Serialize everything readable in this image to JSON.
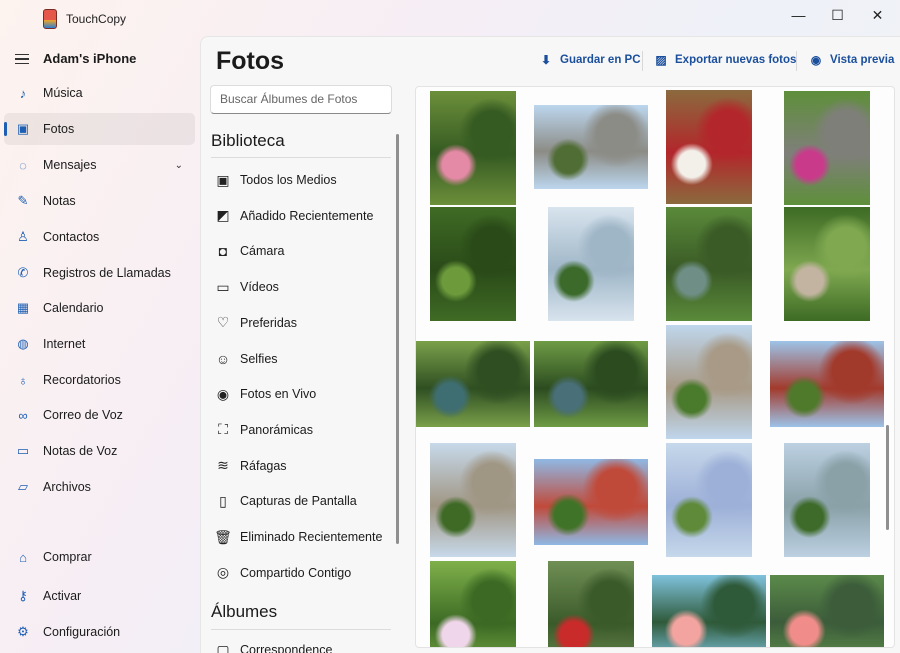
{
  "window": {
    "title": "TouchCopy",
    "minimize": "—",
    "maximize": "☐",
    "close": "✕"
  },
  "sidebar": {
    "device_name": "Adam's iPhone",
    "items": [
      {
        "label": "Música",
        "icon": "music-icon",
        "glyph": "♪"
      },
      {
        "label": "Fotos",
        "icon": "photos-icon",
        "glyph": "▣",
        "active": true
      },
      {
        "label": "Mensajes",
        "icon": "messages-icon",
        "glyph": "◌",
        "expand": "⌄"
      },
      {
        "label": "Notas",
        "icon": "notes-icon",
        "glyph": "✎"
      },
      {
        "label": "Contactos",
        "icon": "contacts-icon",
        "glyph": "♙"
      },
      {
        "label": "Registros de Llamadas",
        "icon": "phone-icon",
        "glyph": "✆"
      },
      {
        "label": "Calendario",
        "icon": "calendar-icon",
        "glyph": "▦"
      },
      {
        "label": "Internet",
        "icon": "globe-icon",
        "glyph": "◍"
      },
      {
        "label": "Recordatorios",
        "icon": "reminders-icon",
        "glyph": "♁"
      },
      {
        "label": "Correo de Voz",
        "icon": "voicemail-icon",
        "glyph": "∞"
      },
      {
        "label": "Notas de Voz",
        "icon": "voice-memo-icon",
        "glyph": "▭"
      },
      {
        "label": "Archivos",
        "icon": "folder-icon",
        "glyph": "▱"
      }
    ],
    "bottom": [
      {
        "label": "Comprar",
        "icon": "cart-icon",
        "glyph": "⌂"
      },
      {
        "label": "Activar",
        "icon": "key-icon",
        "glyph": "⚷"
      },
      {
        "label": "Configuración",
        "icon": "gear-icon",
        "glyph": "⚙"
      }
    ]
  },
  "main": {
    "title": "Fotos",
    "toolbar": {
      "save": {
        "label": "Guardar en PC",
        "glyph": "⬇"
      },
      "export": {
        "label": "Exportar nuevas fotos",
        "glyph": "▨"
      },
      "preview": {
        "label": "Vista previa",
        "glyph": "◉"
      }
    },
    "search_placeholder": "Buscar Álbumes de Fotos",
    "library_heading": "Biblioteca",
    "library": [
      {
        "label": "Todos los Medios",
        "icon": "all-media-icon",
        "glyph": "▣"
      },
      {
        "label": "Añadido Recientemente",
        "icon": "recently-added-icon",
        "glyph": "◩"
      },
      {
        "label": "Cámara",
        "icon": "camera-icon",
        "glyph": "◘"
      },
      {
        "label": "Vídeos",
        "icon": "video-icon",
        "glyph": "▭"
      },
      {
        "label": "Preferidas",
        "icon": "heart-icon",
        "glyph": "♡"
      },
      {
        "label": "Selfies",
        "icon": "selfie-icon",
        "glyph": "☺"
      },
      {
        "label": "Fotos en Vivo",
        "icon": "live-photo-icon",
        "glyph": "◉"
      },
      {
        "label": "Panorámicas",
        "icon": "panorama-icon",
        "glyph": "⛶"
      },
      {
        "label": "Ráfagas",
        "icon": "burst-icon",
        "glyph": "≋"
      },
      {
        "label": "Capturas de Pantalla",
        "icon": "screenshot-icon",
        "glyph": "▯"
      },
      {
        "label": "Eliminado Recientemente",
        "icon": "trash-icon",
        "glyph": "🗑"
      },
      {
        "label": "Compartido Contigo",
        "icon": "shared-icon",
        "glyph": "◎"
      }
    ],
    "albums_heading": "Álbumes",
    "albums": [
      {
        "label": "Correspondence",
        "icon": "album-icon",
        "glyph": "▢"
      }
    ]
  },
  "photos": [
    {
      "subject": "pink flowers",
      "palette": [
        "#6c8f3a",
        "#e58aa6",
        "#355a22"
      ]
    },
    {
      "subject": "dragon tree",
      "palette": [
        "#bcd6ee",
        "#4f6d34",
        "#8c8c86"
      ]
    },
    {
      "subject": "thatched house",
      "palette": [
        "#8b6a3e",
        "#f3f0ea",
        "#b3262b"
      ]
    },
    {
      "subject": "garden wall",
      "palette": [
        "#5e8f3a",
        "#c93a8b",
        "#7f7f7a"
      ]
    },
    {
      "subject": "ferns",
      "palette": [
        "#3f6b25",
        "#6d9b3c",
        "#2a4a18"
      ]
    },
    {
      "subject": "waterfall",
      "palette": [
        "#d8e4ee",
        "#3b6a2a",
        "#9fb6c7"
      ]
    },
    {
      "subject": "pond",
      "palette": [
        "#5a8a3a",
        "#6f8f86",
        "#3a5a26"
      ]
    },
    {
      "subject": "path",
      "palette": [
        "#3d6b24",
        "#c2b4a0",
        "#7fa850"
      ]
    },
    {
      "subject": "pond bridge",
      "palette": [
        "#7aa04a",
        "#3f6e72",
        "#2f4f22"
      ]
    },
    {
      "subject": "pond bridge 2",
      "palette": [
        "#6f9b45",
        "#496f78",
        "#2c4c20"
      ]
    },
    {
      "subject": "palm path",
      "palette": [
        "#bfd6ec",
        "#4a7a2c",
        "#a89a86"
      ]
    },
    {
      "subject": "red pavilion",
      "palette": [
        "#9dc3e8",
        "#4f7a2c",
        "#a23a2c"
      ]
    },
    {
      "subject": "hedge path",
      "palette": [
        "#c7d9ea",
        "#3e6a26",
        "#a09684"
      ]
    },
    {
      "subject": "palms",
      "palette": [
        "#8fb8e4",
        "#3f7428",
        "#c04a3a"
      ]
    },
    {
      "subject": "hydrangeas",
      "palette": [
        "#c6d8ea",
        "#5f8a3a",
        "#9db0d8"
      ]
    },
    {
      "subject": "fountain",
      "palette": [
        "#bcd0e2",
        "#3e6b2a",
        "#8aa1a8"
      ]
    },
    {
      "subject": "orchid",
      "palette": [
        "#7fb04a",
        "#f0d6ea",
        "#3c6a24"
      ]
    },
    {
      "subject": "red flowers",
      "palette": [
        "#6f8f55",
        "#c92b2b",
        "#3b5a2a"
      ]
    },
    {
      "subject": "flamingos 1",
      "palette": [
        "#7fc2dc",
        "#f3a4a0",
        "#2f5a3a"
      ]
    },
    {
      "subject": "flamingos 2",
      "palette": [
        "#5b8a4a",
        "#f08d8a",
        "#3c5c3a"
      ]
    }
  ]
}
